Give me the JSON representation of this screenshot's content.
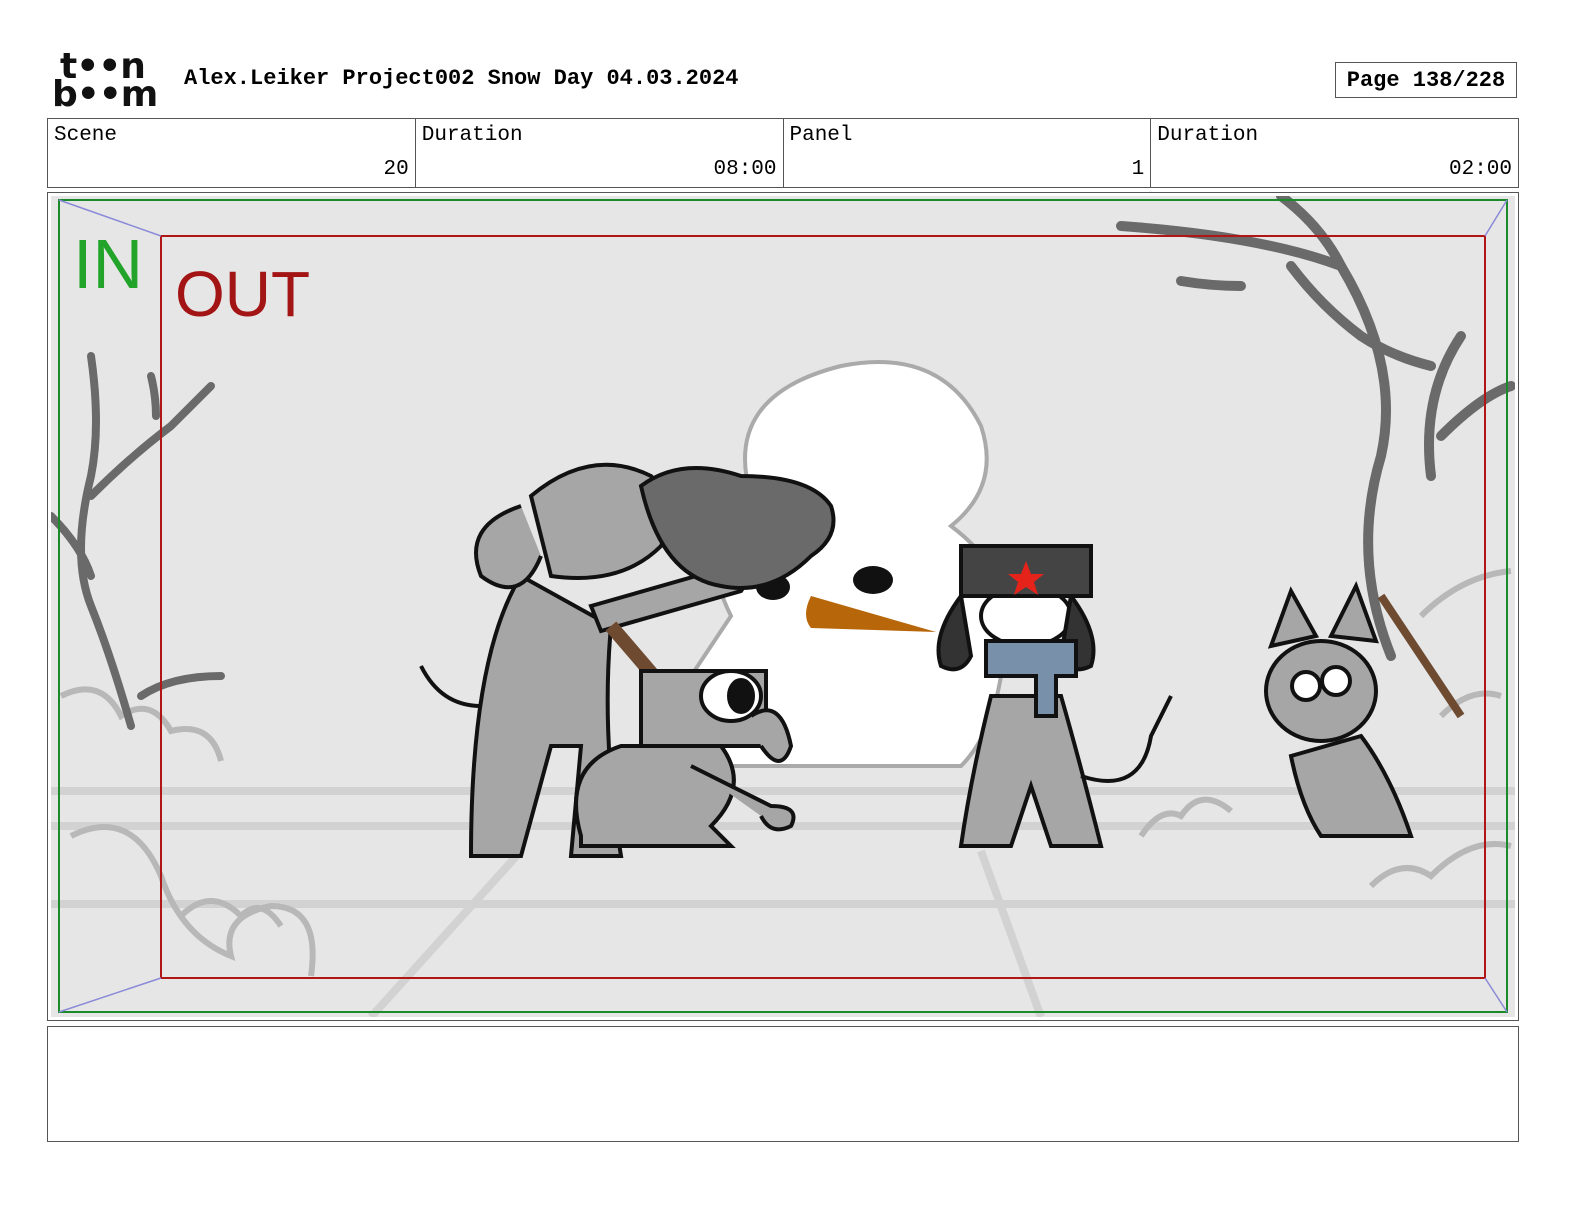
{
  "header": {
    "logo": {
      "top": "t••n",
      "bottom": "b••m",
      "text": "toon boom"
    },
    "title": "Alex.Leiker Project002 Snow Day 04.03.2024",
    "page": "Page 138/228"
  },
  "info": {
    "scene_label": "Scene",
    "scene_value": "20",
    "scene_duration_label": "Duration",
    "scene_duration_value": "08:00",
    "panel_label": "Panel",
    "panel_value": "1",
    "panel_duration_label": "Duration",
    "panel_duration_value": "02:00"
  },
  "panel": {
    "in_label": "IN",
    "out_label": "OUT",
    "colors": {
      "in_frame": "#1a8a2a",
      "in_text": "#22a32a",
      "out_frame": "#b01616",
      "out_text": "#a31414",
      "background": "#e6e6e6",
      "carrot": "#b8660a",
      "scarf": "#7890aa",
      "star": "#e5231b",
      "stick": "#6e4a30"
    }
  },
  "notes": {
    "text": ""
  }
}
